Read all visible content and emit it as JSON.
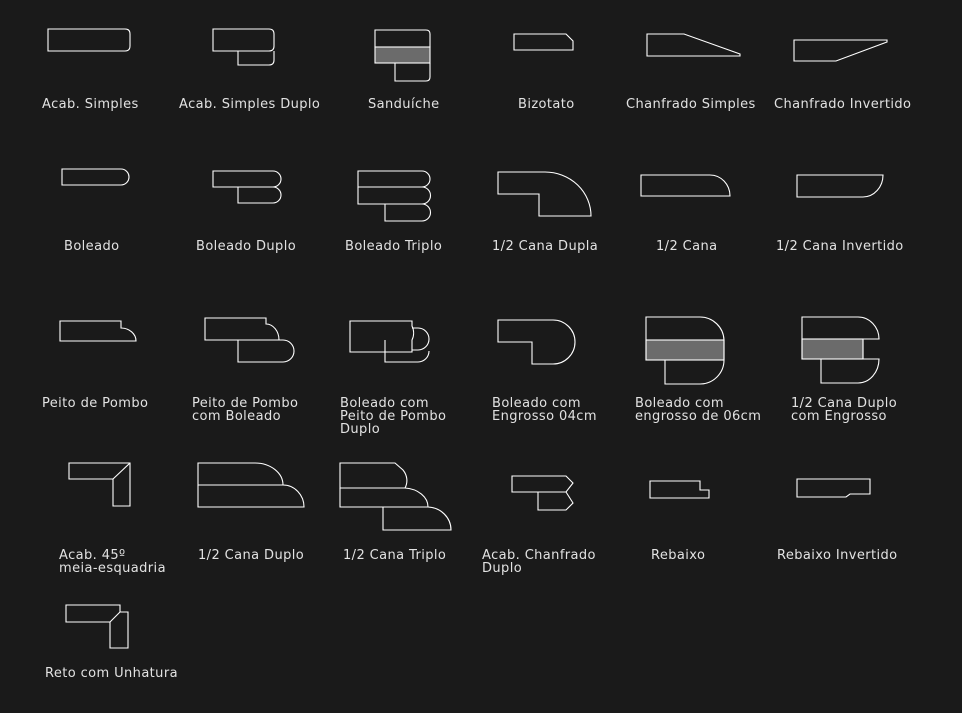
{
  "colors": {
    "background": "#1a1a1a",
    "stroke": "#ffffff",
    "fill_band": "#6b6b6b",
    "text": "#e2e2e2"
  },
  "profiles": [
    {
      "id": "acab-simples",
      "label": "Acab. Simples"
    },
    {
      "id": "acab-simples-duplo",
      "label": "Acab. Simples Duplo"
    },
    {
      "id": "sanduiche",
      "label": "Sanduíche"
    },
    {
      "id": "bizotato",
      "label": "Bizotato"
    },
    {
      "id": "chanfrado-simples",
      "label": "Chanfrado Simples"
    },
    {
      "id": "chanfrado-invertido",
      "label": "Chanfrado Invertido"
    },
    {
      "id": "boleado",
      "label": "Boleado"
    },
    {
      "id": "boleado-duplo",
      "label": "Boleado Duplo"
    },
    {
      "id": "boleado-triplo",
      "label": "Boleado Triplo"
    },
    {
      "id": "meia-cana-dupla",
      "label": "1/2 Cana Dupla"
    },
    {
      "id": "meia-cana",
      "label": "1/2 Cana"
    },
    {
      "id": "meia-cana-invertido",
      "label": "1/2 Cana Invertido"
    },
    {
      "id": "peito-de-pombo",
      "label": "Peito de Pombo"
    },
    {
      "id": "peito-de-pombo-com-boleado",
      "label": "Peito de Pombo\ncom Boleado"
    },
    {
      "id": "boleado-com-peito-de-pombo-duplo",
      "label": "Boleado com\nPeito de Pombo\nDuplo"
    },
    {
      "id": "boleado-com-engrosso-04cm",
      "label": "Boleado com\nEngrosso 04cm"
    },
    {
      "id": "boleado-com-engrosso-06cm",
      "label": "Boleado com\nengrosso de 06cm"
    },
    {
      "id": "meia-cana-duplo-com-engrosso",
      "label": "1/2 Cana Duplo\ncom Engrosso"
    },
    {
      "id": "acab-45-meia-esquadria",
      "label": "Acab. 45º\nmeia-esquadria"
    },
    {
      "id": "meia-cana-duplo",
      "label": "1/2 Cana Duplo"
    },
    {
      "id": "meia-cana-triplo",
      "label": "1/2 Cana Triplo"
    },
    {
      "id": "acab-chanfrado-duplo",
      "label": "Acab. Chanfrado\nDuplo"
    },
    {
      "id": "rebaixo",
      "label": "Rebaixo"
    },
    {
      "id": "rebaixo-invertido",
      "label": "Rebaixo Invertido"
    },
    {
      "id": "reto-com-unhatura",
      "label": "Reto com Unhatura"
    }
  ]
}
